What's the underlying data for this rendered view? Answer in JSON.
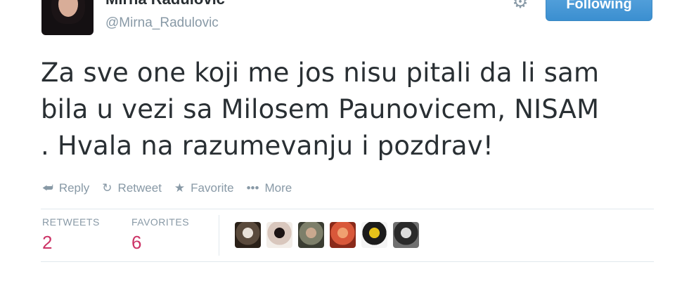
{
  "user": {
    "display_name": "Mirna Radulovic",
    "screen_name": "@Mirna_Radulovic"
  },
  "follow_button": {
    "label": "Following"
  },
  "tweet": {
    "lines": [
      "Za sve one koji me jos nisu pitali da li sam",
      "bila u vezi sa Milosem Paunovicem, NISAM",
      ". Hvala na razumevanju i pozdrav!"
    ]
  },
  "actions": {
    "reply": "Reply",
    "retweet": "Retweet",
    "favorite": "Favorite",
    "more": "More"
  },
  "stats": {
    "retweets_label": "RETWEETS",
    "retweets_value": "2",
    "favorites_label": "FAVORITES",
    "favorites_value": "6"
  },
  "favoriters": [
    {
      "name": "favoriter-1",
      "colors": [
        "#5a4a3c",
        "#e8e0d8",
        "#2a2018"
      ]
    },
    {
      "name": "favoriter-2",
      "colors": [
        "#d9c7bd",
        "#1c1414",
        "#f2ede8"
      ]
    },
    {
      "name": "favoriter-3",
      "colors": [
        "#7d7f6a",
        "#c9a88e",
        "#3b3d32"
      ]
    },
    {
      "name": "favoriter-4",
      "colors": [
        "#d9583a",
        "#f0a070",
        "#8a2a1a"
      ]
    },
    {
      "name": "favoriter-5",
      "colors": [
        "#1c1c1c",
        "#e6c21a",
        "#f4f4f4"
      ]
    },
    {
      "name": "favoriter-6",
      "colors": [
        "#2a2a2a",
        "#dcdcdc",
        "#707070"
      ]
    }
  ]
}
